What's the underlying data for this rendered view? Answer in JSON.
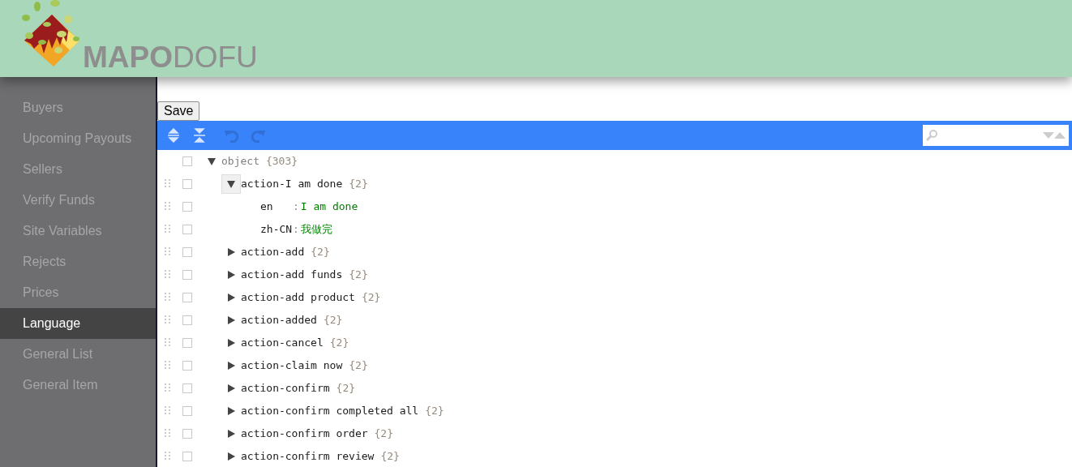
{
  "logo": {
    "bold": "MAPO",
    "light": "DOFU"
  },
  "sidebar": {
    "items": [
      {
        "label": "Buyers",
        "selected": false
      },
      {
        "label": "Upcoming Payouts",
        "selected": false
      },
      {
        "label": "Sellers",
        "selected": false
      },
      {
        "label": "Verify Funds",
        "selected": false
      },
      {
        "label": "Site Variables",
        "selected": false
      },
      {
        "label": "Rejects",
        "selected": false
      },
      {
        "label": "Prices",
        "selected": false
      },
      {
        "label": "Language",
        "selected": true
      },
      {
        "label": "General List",
        "selected": false
      },
      {
        "label": "General Item",
        "selected": false
      }
    ]
  },
  "save_button": "Save",
  "editor": {
    "tree": {
      "kind": "object",
      "key": "object",
      "count": "{303}",
      "expanded": true,
      "focused": false,
      "checked": false,
      "children": [
        {
          "kind": "object",
          "key": "action-I am done",
          "count": "{2}",
          "expanded": true,
          "focused": true,
          "checked": false,
          "children": [
            {
              "kind": "value",
              "key": "en",
              "separator": ":",
              "value": "I am done",
              "checked": false
            },
            {
              "kind": "value",
              "key": "zh-CN",
              "separator": ":",
              "value": "我做完",
              "checked": false
            }
          ]
        },
        {
          "kind": "object",
          "key": "action-add",
          "count": "{2}",
          "expanded": false,
          "focused": false,
          "checked": false
        },
        {
          "kind": "object",
          "key": "action-add funds",
          "count": "{2}",
          "expanded": false,
          "focused": false,
          "checked": false
        },
        {
          "kind": "object",
          "key": "action-add product",
          "count": "{2}",
          "expanded": false,
          "focused": false,
          "checked": false
        },
        {
          "kind": "object",
          "key": "action-added",
          "count": "{2}",
          "expanded": false,
          "focused": false,
          "checked": false
        },
        {
          "kind": "object",
          "key": "action-cancel",
          "count": "{2}",
          "expanded": false,
          "focused": false,
          "checked": false
        },
        {
          "kind": "object",
          "key": "action-claim now",
          "count": "{2}",
          "expanded": false,
          "focused": false,
          "checked": false
        },
        {
          "kind": "object",
          "key": "action-confirm",
          "count": "{2}",
          "expanded": false,
          "focused": false,
          "checked": false
        },
        {
          "kind": "object",
          "key": "action-confirm completed all",
          "count": "{2}",
          "expanded": false,
          "focused": false,
          "checked": false
        },
        {
          "kind": "object",
          "key": "action-confirm order",
          "count": "{2}",
          "expanded": false,
          "focused": false,
          "checked": false
        },
        {
          "kind": "object",
          "key": "action-confirm review",
          "count": "{2}",
          "expanded": false,
          "focused": false,
          "checked": false
        }
      ]
    }
  }
}
